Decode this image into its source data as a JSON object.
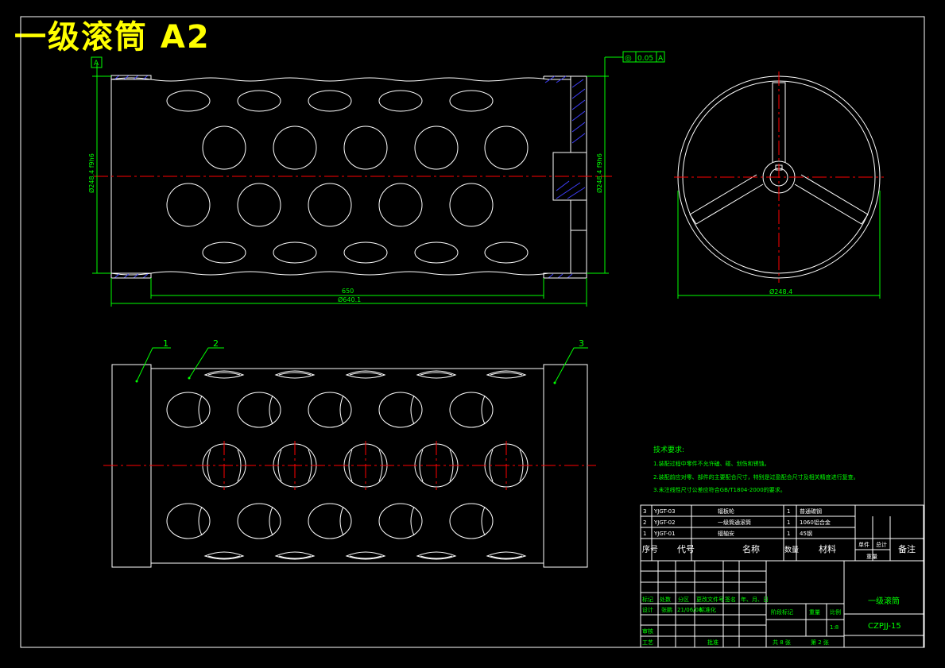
{
  "drawing_title": "一级滚筒 A2",
  "datum_label": "A",
  "tolerance": {
    "symbol": "◎",
    "value": "0.05",
    "datum": "A"
  },
  "dimensions": {
    "left_diameter": "Ø248.4 f9h6",
    "right_diameter": "Ø248.4 f9h6",
    "inner_length": "650",
    "overall_length": "Ø640.1",
    "circle_diameter": "Ø248.4"
  },
  "balloons": [
    "1",
    "2",
    "3"
  ],
  "tech_requirements": {
    "heading": "技术要求:",
    "items": [
      "1.装配过程中零件不允许磕、碰、划伤和锈蚀。",
      "2.装配前应对零、部件的主要配合尺寸，特别是过盈配合尺寸及相关精度进行复查。",
      "3.未注线性尺寸公差应符合GB/T1804-2000的要求。"
    ]
  },
  "bom": {
    "rows": [
      [
        "3",
        "YJGT-03",
        "辐板轮",
        "1",
        "普通碳钢",
        "",
        "",
        ""
      ],
      [
        "2",
        "YJGT-02",
        "一级筒通滚筒",
        "1",
        "1060铝合金",
        "",
        "",
        ""
      ],
      [
        "1",
        "YJGT-01",
        "辐轴安",
        "1",
        "45钢",
        "",
        "",
        ""
      ]
    ],
    "header": [
      "序号",
      "代号",
      "名称",
      "数量",
      "材料",
      "单件",
      "总计",
      "备注"
    ],
    "header_sub": "重量"
  },
  "title_block": {
    "row_labels": [
      "标记",
      "处数",
      "分区",
      "更改文件号",
      "签名",
      "年、月、日"
    ],
    "design_label": "设计",
    "designer": "张鹏",
    "date": "21/06/08",
    "standardize": "标准化",
    "stage_mark": "阶段标记",
    "weight": "重量",
    "scale": "比例",
    "scale_value": "1:8",
    "review": "审核",
    "process": "工艺",
    "approve": "批准",
    "sheets_total": "共 8 张",
    "sheet_no": "第 2 张",
    "part_name": "一级滚筒",
    "drawing_no": "CZPJJ-15"
  }
}
